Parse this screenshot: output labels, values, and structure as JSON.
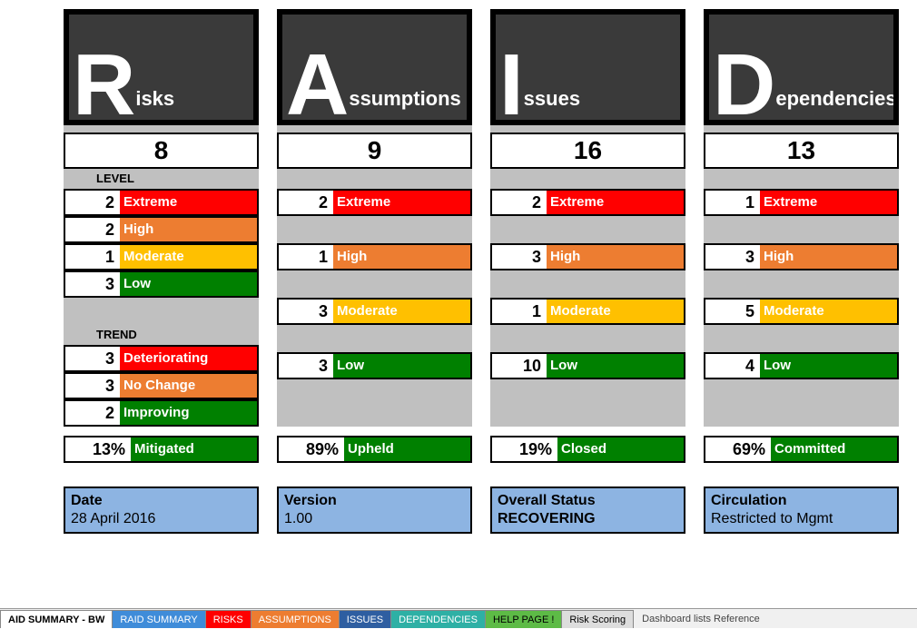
{
  "columns": [
    {
      "head_big": "R",
      "head_rest": "isks",
      "count": "8",
      "level_label": "LEVEL",
      "levels": [
        {
          "n": "2",
          "label": "Extreme",
          "cls": "c-extreme"
        },
        {
          "n": "2",
          "label": "High",
          "cls": "c-high"
        },
        {
          "n": "1",
          "label": "Moderate",
          "cls": "c-moderate"
        },
        {
          "n": "3",
          "label": "Low",
          "cls": "c-low"
        }
      ],
      "trend_label": "TREND",
      "trends": [
        {
          "n": "3",
          "label": "Deteriorating",
          "cls": "c-deteriorating"
        },
        {
          "n": "3",
          "label": "No Change",
          "cls": "c-nochange"
        },
        {
          "n": "2",
          "label": "Improving",
          "cls": "c-improving"
        }
      ],
      "footer": {
        "n": "13%",
        "label": "Mitigated",
        "cls": "c-mitigated"
      }
    },
    {
      "head_big": "A",
      "head_rest": "ssumptions",
      "count": "9",
      "levels": [
        {
          "n": "2",
          "label": "Extreme",
          "cls": "c-extreme"
        },
        {
          "n": "1",
          "label": "High",
          "cls": "c-high"
        },
        {
          "n": "3",
          "label": "Moderate",
          "cls": "c-moderate"
        },
        {
          "n": "3",
          "label": "Low",
          "cls": "c-low"
        }
      ],
      "footer": {
        "n": "89%",
        "label": "Upheld",
        "cls": "c-upheld"
      }
    },
    {
      "head_big": "I",
      "head_rest": "ssues",
      "count": "16",
      "levels": [
        {
          "n": "2",
          "label": "Extreme",
          "cls": "c-extreme"
        },
        {
          "n": "3",
          "label": "High",
          "cls": "c-high"
        },
        {
          "n": "1",
          "label": "Moderate",
          "cls": "c-moderate"
        },
        {
          "n": "10",
          "label": "Low",
          "cls": "c-low"
        }
      ],
      "footer": {
        "n": "19%",
        "label": "Closed",
        "cls": "c-closed"
      }
    },
    {
      "head_big": "D",
      "head_rest": "ependencies",
      "count": "13",
      "levels": [
        {
          "n": "1",
          "label": "Extreme",
          "cls": "c-extreme"
        },
        {
          "n": "3",
          "label": "High",
          "cls": "c-high"
        },
        {
          "n": "5",
          "label": "Moderate",
          "cls": "c-moderate"
        },
        {
          "n": "4",
          "label": "Low",
          "cls": "c-low"
        }
      ],
      "footer": {
        "n": "69%",
        "label": "Committed",
        "cls": "c-committed"
      }
    }
  ],
  "info": [
    {
      "label": "Date",
      "value": "28 April 2016"
    },
    {
      "label": "Version",
      "value": "1.00"
    },
    {
      "label": "Overall Status",
      "value": "RECOVERING",
      "value_bold": true
    },
    {
      "label": "Circulation",
      "value": "Restricted to Mgmt"
    }
  ],
  "tabs": [
    {
      "label": "AID SUMMARY - BW",
      "cls": "t-white tab-active"
    },
    {
      "label": "RAID SUMMARY",
      "cls": "t-blue"
    },
    {
      "label": "RISKS",
      "cls": "t-red"
    },
    {
      "label": "ASSUMPTIONS",
      "cls": "t-orange"
    },
    {
      "label": "ISSUES",
      "cls": "t-darkblue"
    },
    {
      "label": "DEPENDENCIES",
      "cls": "t-teal"
    },
    {
      "label": "HELP PAGE !",
      "cls": "t-green"
    },
    {
      "label": "Risk Scoring",
      "cls": "t-gray"
    }
  ],
  "tab_trail": "Dashboard lists Reference",
  "chart_data": {
    "type": "table",
    "title": "RAID Summary",
    "categories": [
      "Risks",
      "Assumptions",
      "Issues",
      "Dependencies"
    ],
    "counts": [
      8,
      9,
      16,
      13
    ],
    "levels": {
      "Extreme": [
        2,
        2,
        2,
        1
      ],
      "High": [
        2,
        1,
        3,
        3
      ],
      "Moderate": [
        1,
        3,
        1,
        5
      ],
      "Low": [
        3,
        3,
        10,
        4
      ]
    },
    "risks_trend": {
      "Deteriorating": 3,
      "No Change": 3,
      "Improving": 2
    },
    "status_percent": {
      "Mitigated": 13,
      "Upheld": 89,
      "Closed": 19,
      "Committed": 69
    }
  }
}
